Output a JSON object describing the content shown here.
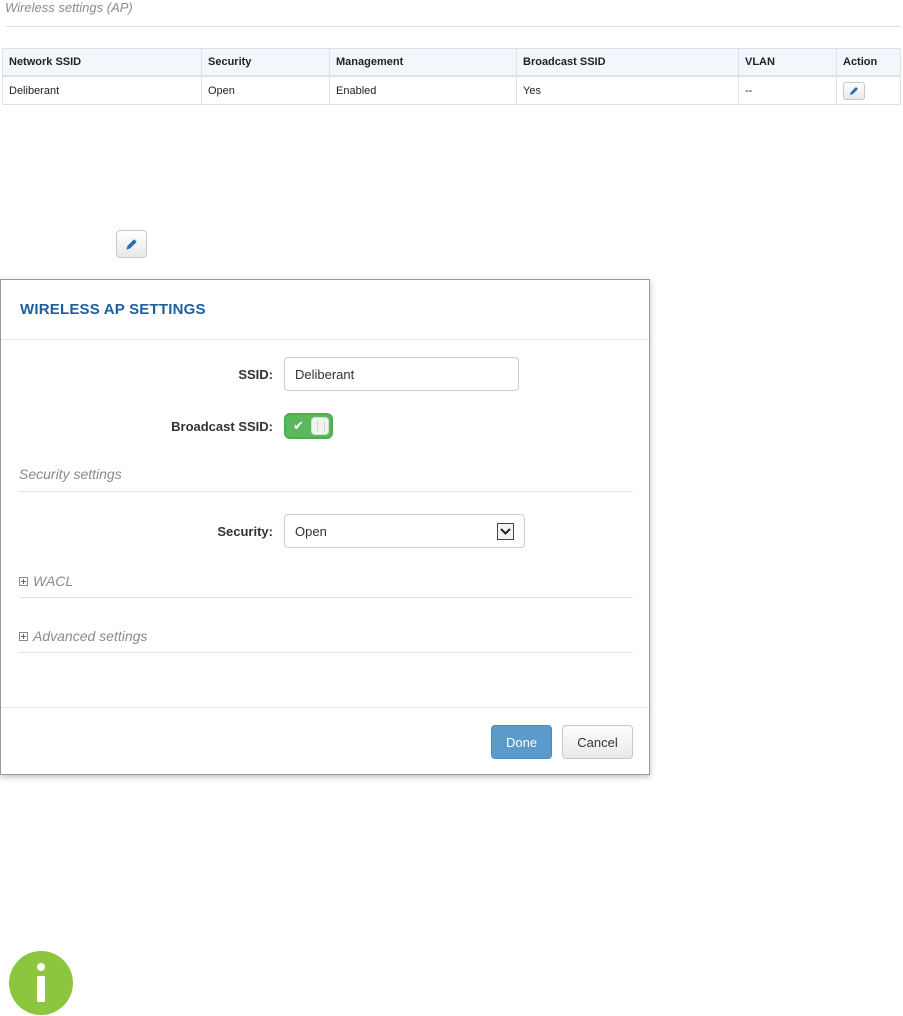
{
  "section": {
    "title": "Wireless settings (AP)"
  },
  "table": {
    "headers": [
      "Network SSID",
      "Security",
      "Management",
      "Broadcast SSID",
      "VLAN",
      "Action"
    ],
    "rows": [
      {
        "ssid": "Deliberant",
        "security": "Open",
        "management": "Enabled",
        "broadcast": "Yes",
        "vlan": "--",
        "action_icon": "pencil-icon"
      }
    ]
  },
  "standalone_edit": {
    "icon": "pencil-icon"
  },
  "modal": {
    "title": "WIRELESS AP SETTINGS",
    "ssid": {
      "label": "SSID:",
      "value": "Deliberant"
    },
    "broadcast": {
      "label": "Broadcast SSID:",
      "state": "on"
    },
    "security_section": {
      "title": "Security settings"
    },
    "security": {
      "label": "Security:",
      "value": "Open"
    },
    "wacl": {
      "title": "WACL"
    },
    "advanced": {
      "title": "Advanced settings"
    },
    "buttons": {
      "done": "Done",
      "cancel": "Cancel"
    }
  },
  "colors": {
    "title_blue": "#1e5fa0",
    "toggle_green": "#5cb85c",
    "done_button": "#5a9bcb",
    "info_green": "#8cc63f",
    "pencil_blue": "#2a6bb8"
  },
  "info_icon": {
    "icon": "info-icon"
  }
}
